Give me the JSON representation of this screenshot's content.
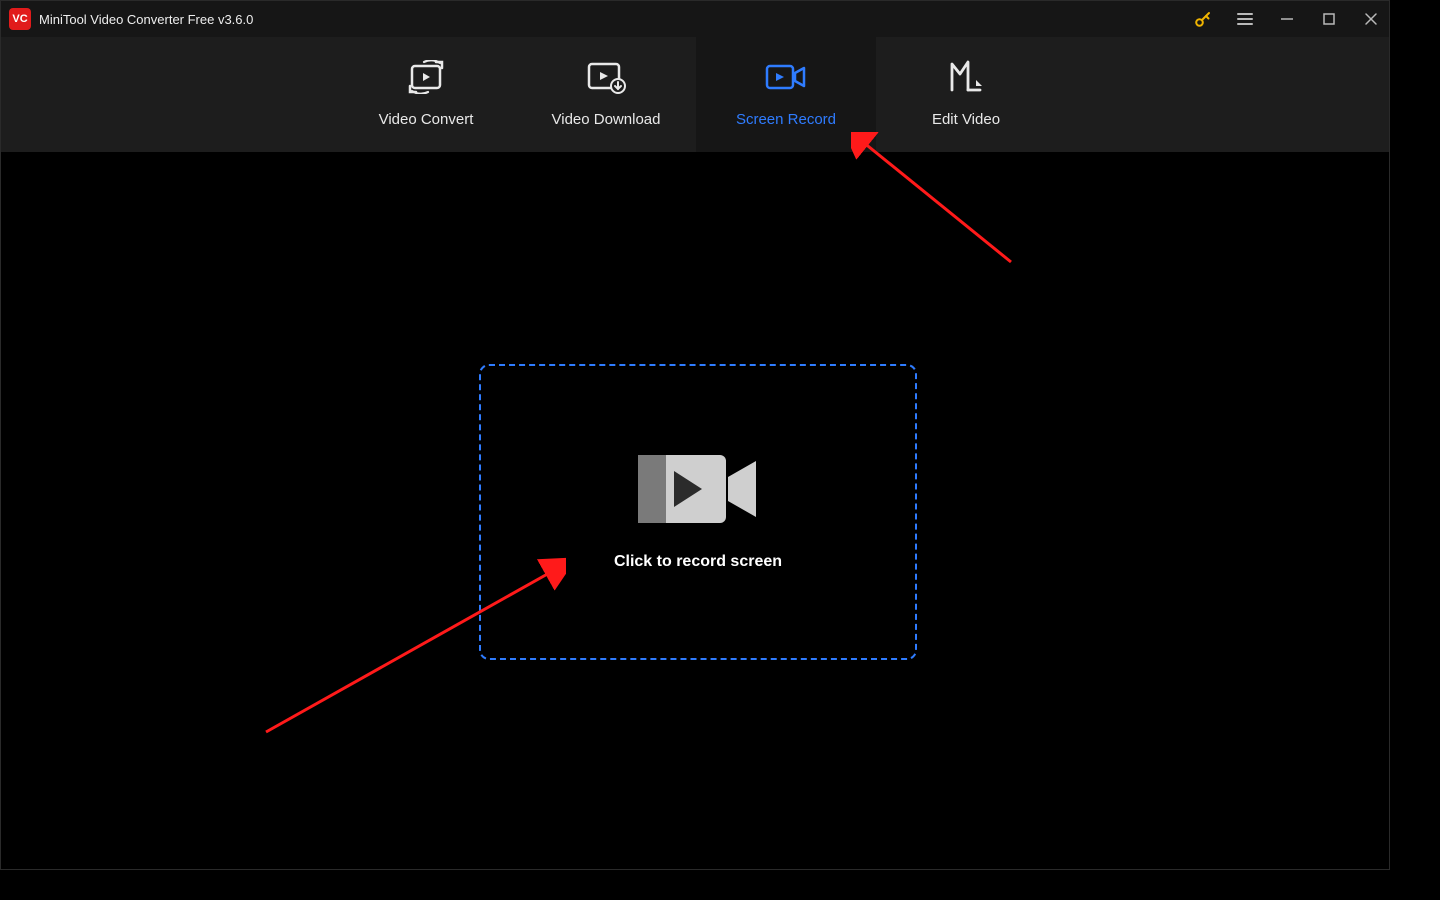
{
  "titlebar": {
    "logo_text": "VC",
    "title": "MiniTool Video Converter Free v3.6.0"
  },
  "tabs": [
    {
      "id": "convert",
      "label": "Video Convert",
      "active": false
    },
    {
      "id": "download",
      "label": "Video Download",
      "active": false
    },
    {
      "id": "record",
      "label": "Screen Record",
      "active": true
    },
    {
      "id": "edit",
      "label": "Edit Video",
      "active": false
    }
  ],
  "main": {
    "record_prompt": "Click to record screen"
  },
  "colors": {
    "accent": "#2f7cff",
    "annotation": "#ff1a1a"
  }
}
